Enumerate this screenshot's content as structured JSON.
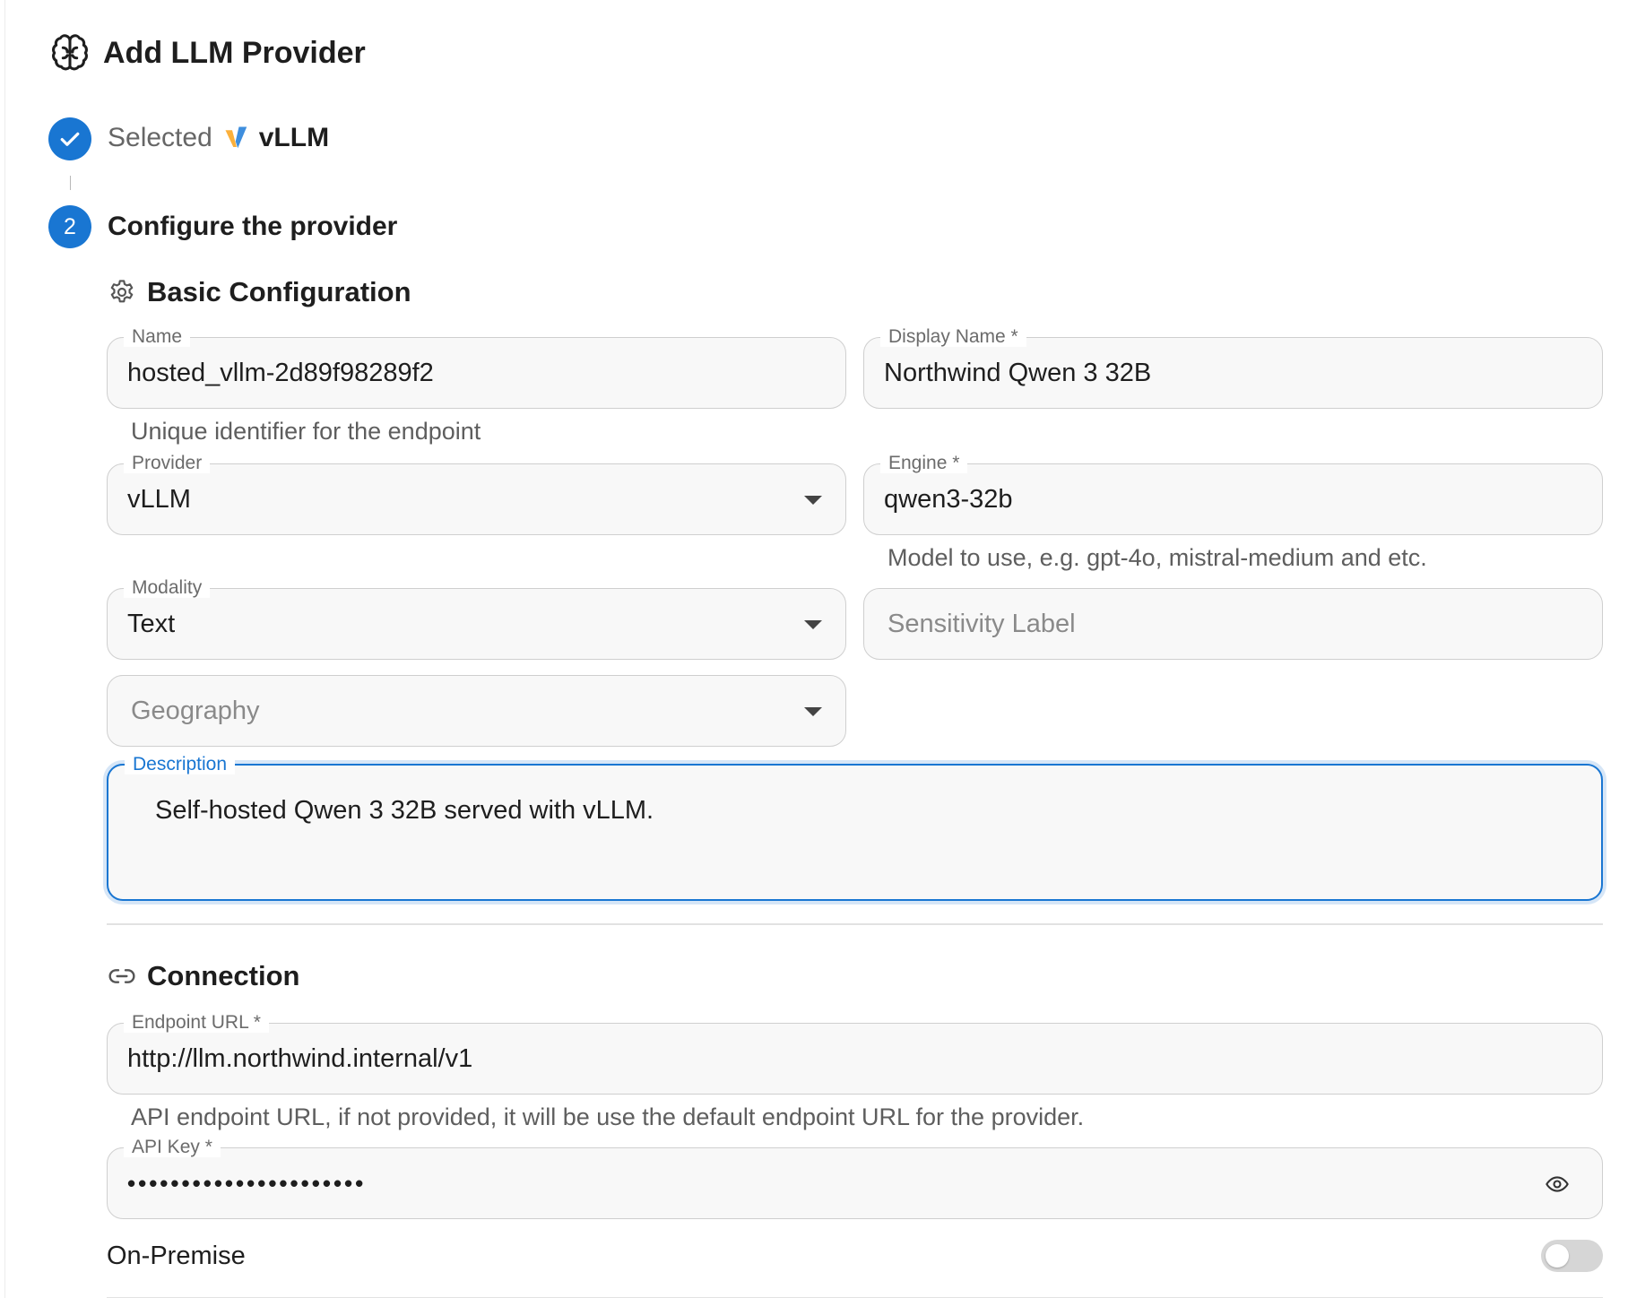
{
  "dialog": {
    "title": "Add LLM Provider",
    "icon": "brain-icon"
  },
  "steps": {
    "step1": {
      "prefix": "Selected",
      "provider": "vLLM",
      "state": "completed"
    },
    "step2": {
      "number": "2",
      "label": "Configure the provider",
      "state": "active"
    }
  },
  "basic": {
    "heading": "Basic Configuration",
    "name": {
      "label": "Name",
      "value": "hosted_vllm-2d89f98289f2",
      "helper": "Unique identifier for the endpoint"
    },
    "display_name": {
      "label": "Display Name *",
      "value": "Northwind Qwen 3 32B"
    },
    "provider": {
      "label": "Provider",
      "value": "vLLM"
    },
    "engine": {
      "label": "Engine *",
      "value": "qwen3-32b",
      "helper": "Model to use, e.g. gpt-4o, mistral-medium and etc."
    },
    "modality": {
      "label": "Modality",
      "value": "Text"
    },
    "sensitivity": {
      "placeholder": "Sensitivity Label"
    },
    "geography": {
      "placeholder": "Geography"
    },
    "description": {
      "label": "Description",
      "value": "Self-hosted Qwen 3 32B served with vLLM."
    }
  },
  "connection": {
    "heading": "Connection",
    "endpoint": {
      "label": "Endpoint URL *",
      "value": "http://llm.northwind.internal/v1",
      "helper": "API endpoint URL, if not provided, it will be use the default endpoint URL for the provider."
    },
    "api_key": {
      "label": "API Key *",
      "value": "••••••••••••••••••••••"
    },
    "on_premise": {
      "label": "On-Premise",
      "enabled": false
    }
  },
  "colors": {
    "accent": "#1976d2",
    "border": "#cfcfcf",
    "field_bg": "#f8f8f8"
  }
}
